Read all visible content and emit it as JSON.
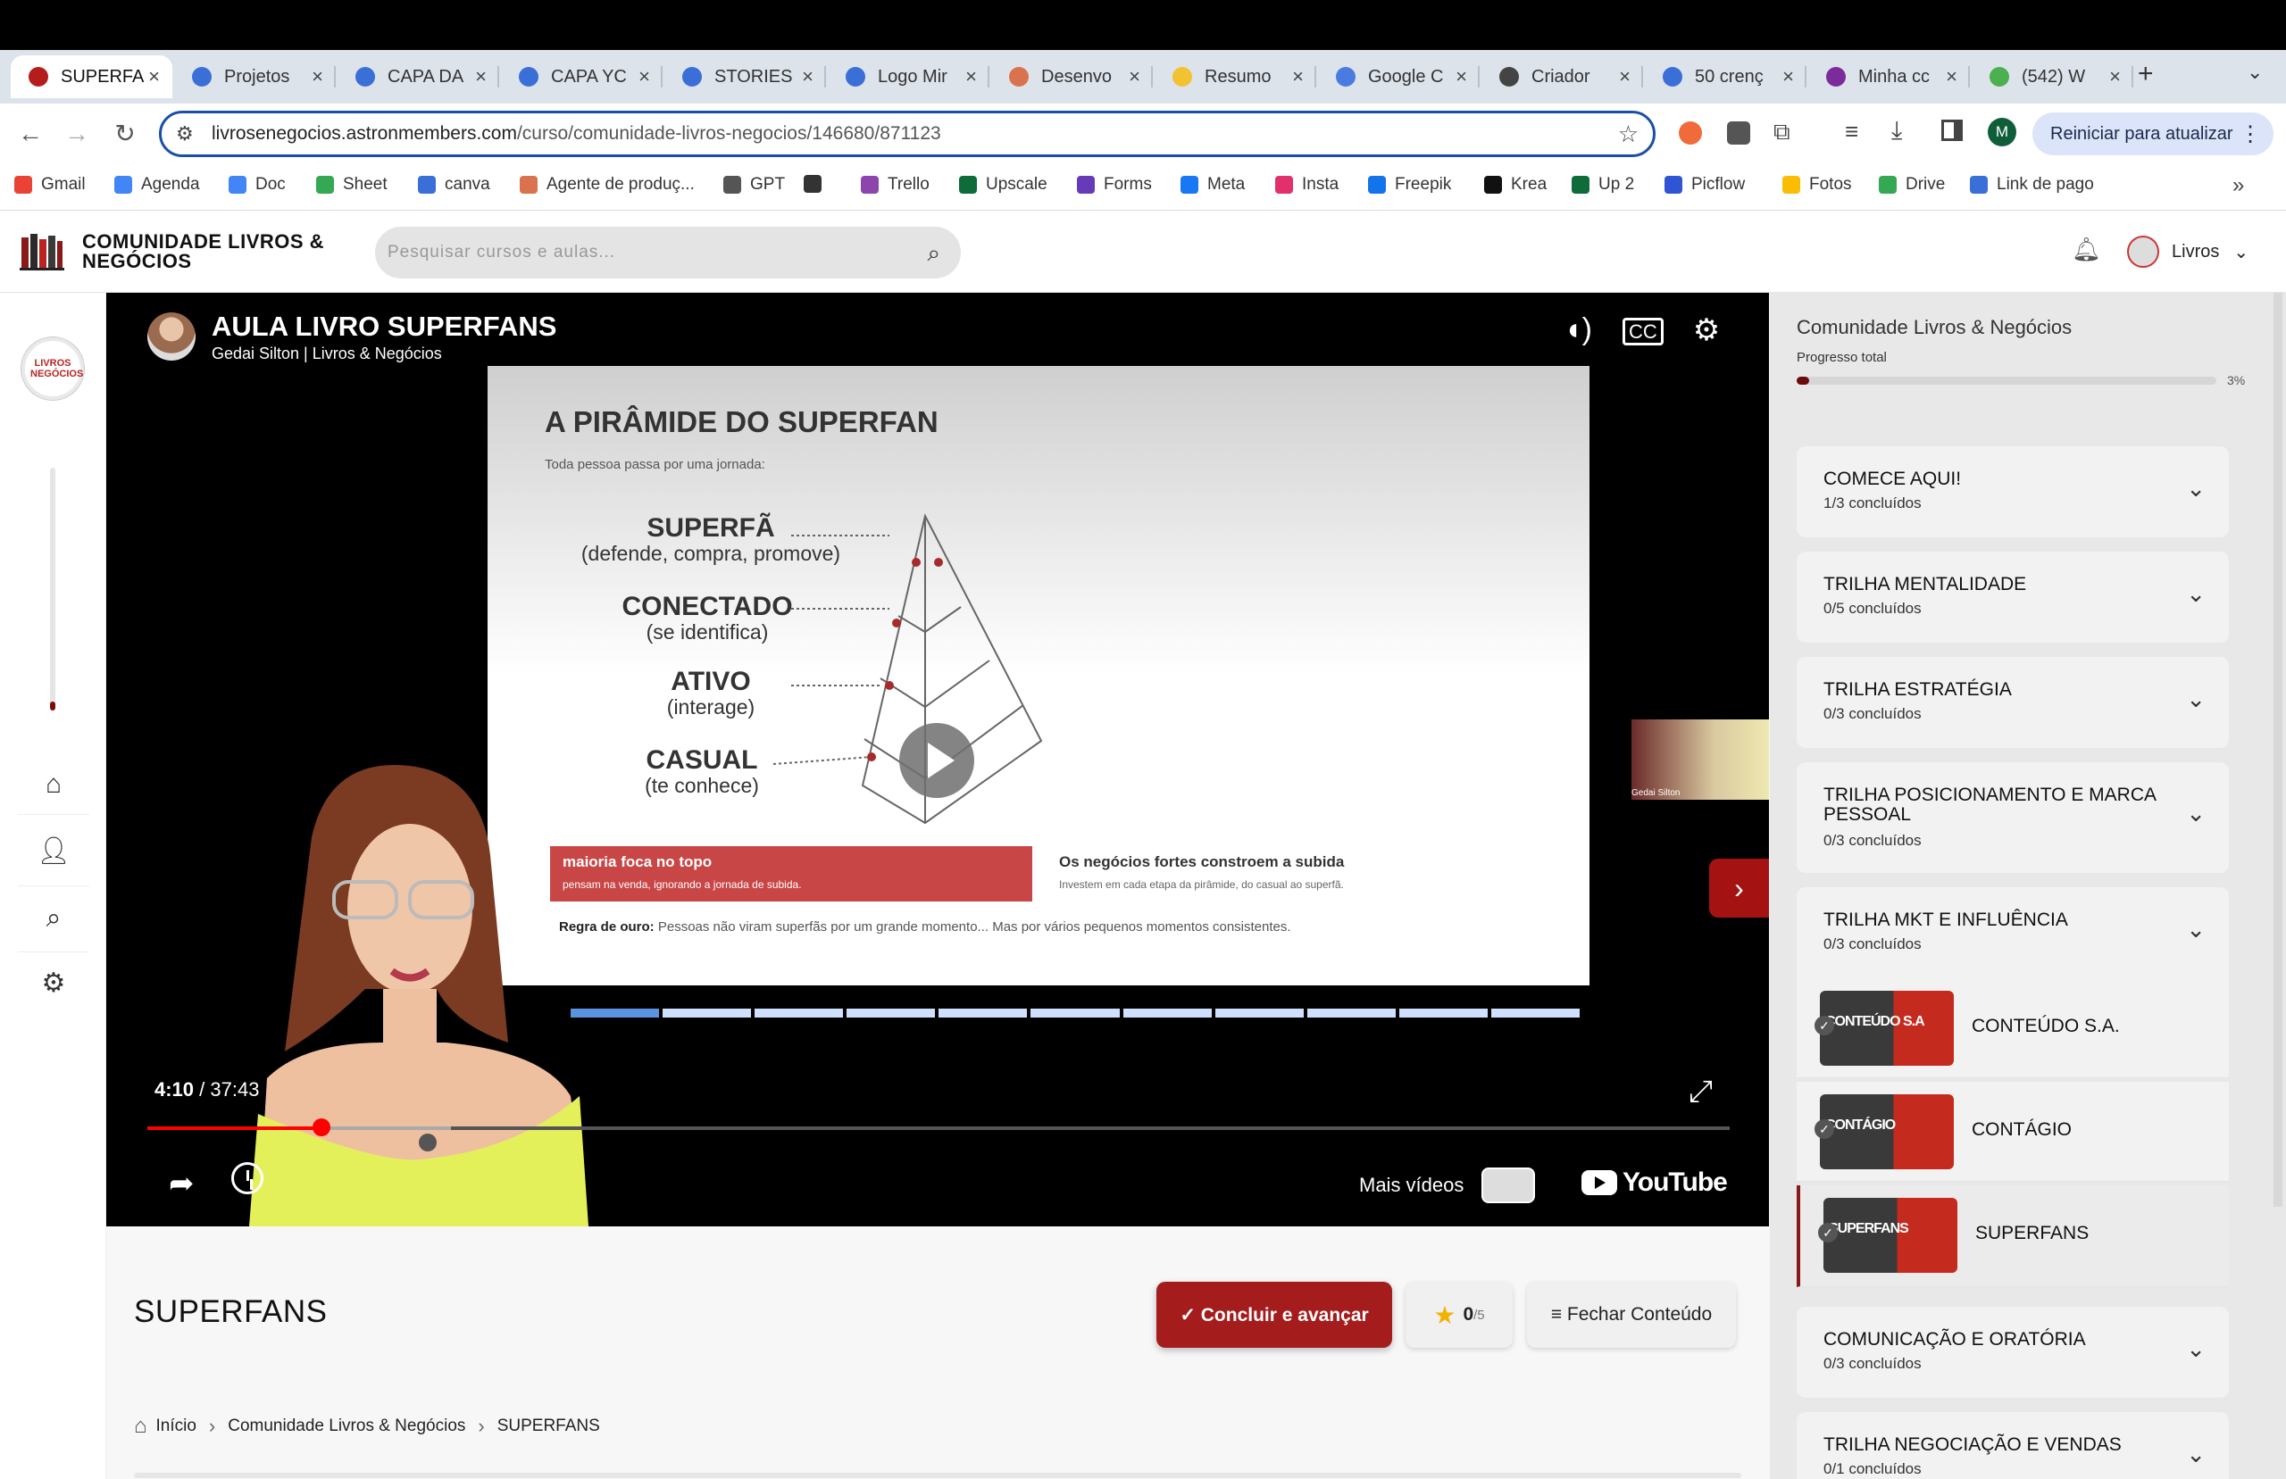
{
  "browser": {
    "tabs": [
      {
        "label": "SUPERFA",
        "active": true,
        "color": "#b71c1c"
      },
      {
        "label": "Projetos",
        "color": "#3b6fd8"
      },
      {
        "label": "CAPA DA",
        "color": "#3b6fd8"
      },
      {
        "label": "CAPA YC",
        "color": "#3b6fd8"
      },
      {
        "label": "STORIES",
        "color": "#3b6fd8"
      },
      {
        "label": "Logo Mir",
        "color": "#3b6fd8"
      },
      {
        "label": "Desenvo",
        "color": "#d9734e"
      },
      {
        "label": "Resumo",
        "color": "#f2c230"
      },
      {
        "label": "Google C",
        "color": "#4a7be0"
      },
      {
        "label": "Criador",
        "color": "#444444"
      },
      {
        "label": "50 crenç",
        "color": "#3b6fd8"
      },
      {
        "label": "Minha cc",
        "color": "#7b2c9a"
      },
      {
        "label": "(542) W",
        "color": "#4caf50"
      }
    ],
    "url_host": "livrosenegocios.astronmembers.com",
    "url_path": "/curso/comunidade-livros-negocios/146680/871123",
    "restart_label": "Reiniciar para atualizar",
    "profile_initial": "M",
    "bookmarks": [
      {
        "label": "Gmail",
        "color": "#ea4335"
      },
      {
        "label": "Agenda",
        "color": "#4285f4"
      },
      {
        "label": "Doc",
        "color": "#4285f4"
      },
      {
        "label": "Sheet",
        "color": "#34a853"
      },
      {
        "label": "canva",
        "color": "#3b6fd8"
      },
      {
        "label": "Agente de produç...",
        "color": "#d9734e"
      },
      {
        "label": "GPT",
        "color": "#555555"
      },
      {
        "label": "",
        "color": "#333333"
      },
      {
        "label": "Trello",
        "color": "#8e44ad"
      },
      {
        "label": "Upscale",
        "color": "#0f6b3a"
      },
      {
        "label": "Forms",
        "color": "#673ab7"
      },
      {
        "label": "Meta",
        "color": "#1877f2"
      },
      {
        "label": "Insta",
        "color": "#e1306c"
      },
      {
        "label": "Freepik",
        "color": "#1273eb"
      },
      {
        "label": "Krea",
        "color": "#111111"
      },
      {
        "label": "Up 2",
        "color": "#0f6b3a"
      },
      {
        "label": "Picflow",
        "color": "#2f55d4"
      },
      {
        "label": "Fotos",
        "color": "#fbbc05"
      },
      {
        "label": "Drive",
        "color": "#34a853"
      },
      {
        "label": "Link de pago",
        "color": "#3b6fd8"
      }
    ]
  },
  "site": {
    "brand_line1": "COMUNIDADE LIVROS &",
    "brand_line2": "NEGÓCIOS",
    "search_placeholder": "Pesquisar cursos e aulas...",
    "user_name": "Livros",
    "rail_avatar_text": "LIVROS NEGÓCIOS"
  },
  "video": {
    "title": "AULA LIVRO SUPERFANS",
    "channel": "Gedai Silton | Livros & Negócios",
    "current_time": "4:10",
    "duration": "37:43",
    "progress": 0.11,
    "more_videos": "Mais vídeos",
    "youtube": "YouTube",
    "thumb_caption": "Gedai Silton",
    "slide": {
      "title": "A PIRÂMIDE DO SUPERFAN",
      "subtitle": "Toda pessoa passa por uma jornada:",
      "levels": [
        {
          "name": "SUPERFÃ",
          "desc": "(defende, compra, promove)"
        },
        {
          "name": "CONECTADO",
          "desc": "(se identifica)"
        },
        {
          "name": "ATIVO",
          "desc": "(interage)"
        },
        {
          "name": "CASUAL",
          "desc": "(te conhece)"
        }
      ],
      "red_title": "maioria foca no topo",
      "red_text": "pensam na venda, ignorando a jornada de subida.",
      "grey_title": "Os negócios fortes constroem a subida",
      "grey_text": "Investem em cada etapa da pirâmide, do casual ao superfã.",
      "golden_label": "Regra de ouro:",
      "golden_text": "Pessoas não viram superfãs por um grande momento... Mas por vários pequenos momentos consistentes."
    }
  },
  "lesson": {
    "title": "SUPERFANS",
    "complete_label": "✓ Concluir e avançar",
    "rating_value": "0",
    "rating_max": "/5",
    "close_label": "≡ Fechar Conteúdo",
    "breadcrumb": [
      "Início",
      "Comunidade Livros & Negócios",
      "SUPERFANS"
    ]
  },
  "panel": {
    "title": "Comunidade Livros & Negócios",
    "progress_label": "Progresso total",
    "progress_percent": "3%",
    "progress_value": 0.03,
    "modules": [
      {
        "title": "COMECE AQUI!",
        "status": "1/3 concluídos"
      },
      {
        "title": "TRILHA MENTALIDADE",
        "status": "0/5 concluídos"
      },
      {
        "title": "TRILHA ESTRATÉGIA",
        "status": "0/3 concluídos"
      },
      {
        "title": "TRILHA POSICIONAMENTO E MARCA PESSOAL",
        "status": "0/3 concluídos"
      },
      {
        "title": "TRILHA MKT E INFLUÊNCIA",
        "status": "0/3 concluídos"
      },
      {
        "title": "COMUNICAÇÃO E ORATÓRIA",
        "status": "0/3 concluídos"
      },
      {
        "title": "TRILHA NEGOCIAÇÃO E VENDAS",
        "status": "0/1 concluídos"
      }
    ],
    "lessons": [
      {
        "title": "CONTEÚDO S.A.",
        "thumb_text": "CONTEÚDO S.A"
      },
      {
        "title": "CONTÁGIO",
        "thumb_text": "CONTÁGIO"
      },
      {
        "title": "SUPERFANS",
        "thumb_text": "SUPERFANS",
        "current": true
      }
    ]
  }
}
